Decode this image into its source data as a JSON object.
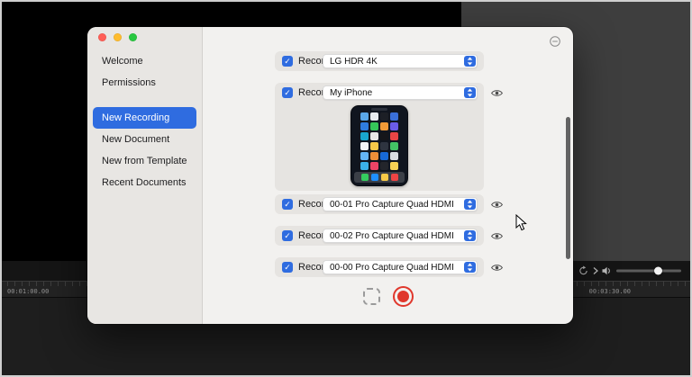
{
  "colors": {
    "accent_blue": "#2f6ce0",
    "record_red": "#e0372c",
    "traffic_red": "#ff5f57",
    "traffic_yellow": "#febc2e",
    "traffic_green": "#28c840"
  },
  "icons": {
    "check": "✓",
    "collapse": "circle-minus",
    "eye": "eye-outline",
    "region": "dashed-rect",
    "record": "red-dot",
    "loop": "loop-arrow",
    "play": "chevron-right",
    "volume": "speaker"
  },
  "sidebar": {
    "items": [
      {
        "label": "Welcome",
        "selected": false
      },
      {
        "label": "Permissions",
        "selected": false
      },
      {
        "label": "New Recording",
        "selected": true
      },
      {
        "label": "New Document",
        "selected": false
      },
      {
        "label": "New from Template",
        "selected": false
      },
      {
        "label": "Recent Documents",
        "selected": false
      }
    ]
  },
  "sources": {
    "record_label": "Record:",
    "rows": [
      {
        "value": "LG HDR 4K",
        "checked": true,
        "eye": false
      },
      {
        "value": "My iPhone",
        "checked": true,
        "eye": true,
        "preview": "iphone-screen"
      },
      {
        "value": "00-01 Pro Capture Quad HDMI",
        "checked": true,
        "eye": true
      },
      {
        "value": "00-02 Pro Capture Quad HDMI",
        "checked": true,
        "eye": true
      },
      {
        "value": "00-00 Pro Capture Quad HDMI",
        "checked": true,
        "eye": true
      }
    ]
  },
  "phone_preview": {
    "icon_rows": [
      [
        "#5aa7e8",
        "#e8ecf0",
        "#1c1f26",
        "#3a6fd8"
      ],
      [
        "#2f7de1",
        "#35c759",
        "#f09a37",
        "#6b5ce7"
      ],
      [
        "#19a7ce",
        "#e8e8e8",
        "#15161a",
        "#e84545"
      ],
      [
        "#f5f5f7",
        "#f7c948",
        "#2e3440",
        "#43c465"
      ],
      [
        "#64b5f6",
        "#ef8e38",
        "#1769d6",
        "#d9dde2"
      ],
      [
        "#3bb2e8",
        "#ee4466",
        "#23252b",
        "#f7d154"
      ]
    ],
    "dock_colors": [
      "#35cc5f",
      "#1f8fff",
      "#f7c948",
      "#ee4444"
    ]
  },
  "timeline": {
    "start_label": "00:01:00.00",
    "end_label": "00:03:30.00"
  }
}
